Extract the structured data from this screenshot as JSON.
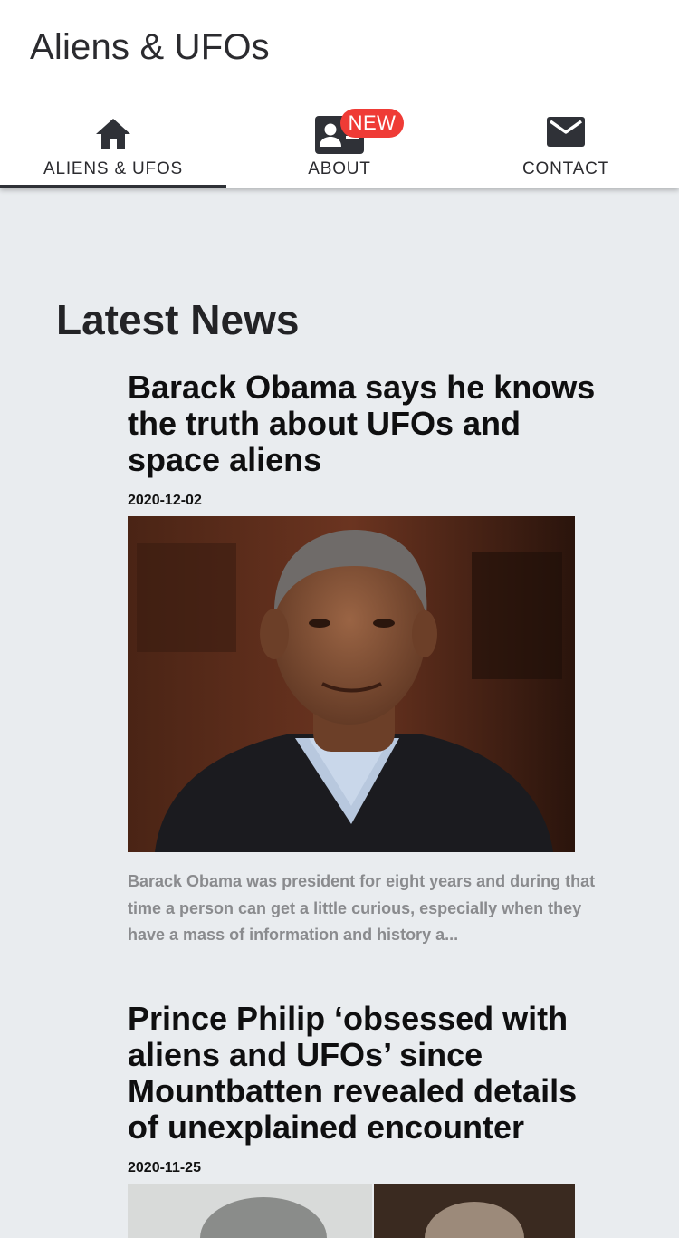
{
  "app": {
    "title": "Aliens & UFOs"
  },
  "tabs": [
    {
      "label": "ALIENS & UFOS",
      "icon": "home-icon",
      "active": true
    },
    {
      "label": "ABOUT",
      "icon": "contact-card-icon",
      "badge": "NEW"
    },
    {
      "label": "CONTACT",
      "icon": "mail-icon"
    }
  ],
  "main": {
    "section_title": "Latest News",
    "articles": [
      {
        "title": "Barack Obama says he knows the truth about UFOs and space aliens",
        "date": "2020-12-02",
        "excerpt": "Barack Obama was president for eight years and during that time a person can get a little curious, especially when they have a mass of information and history a..."
      },
      {
        "title": "Prince Philip ‘obsessed with aliens and UFOs’ since Mountbatten revealed details of unexplained encounter",
        "date": "2020-11-25"
      }
    ]
  },
  "colors": {
    "background": "#e9ecef",
    "appbar": "#ffffff",
    "badge": "#ef3b36",
    "active_indicator": "#2f3137"
  }
}
